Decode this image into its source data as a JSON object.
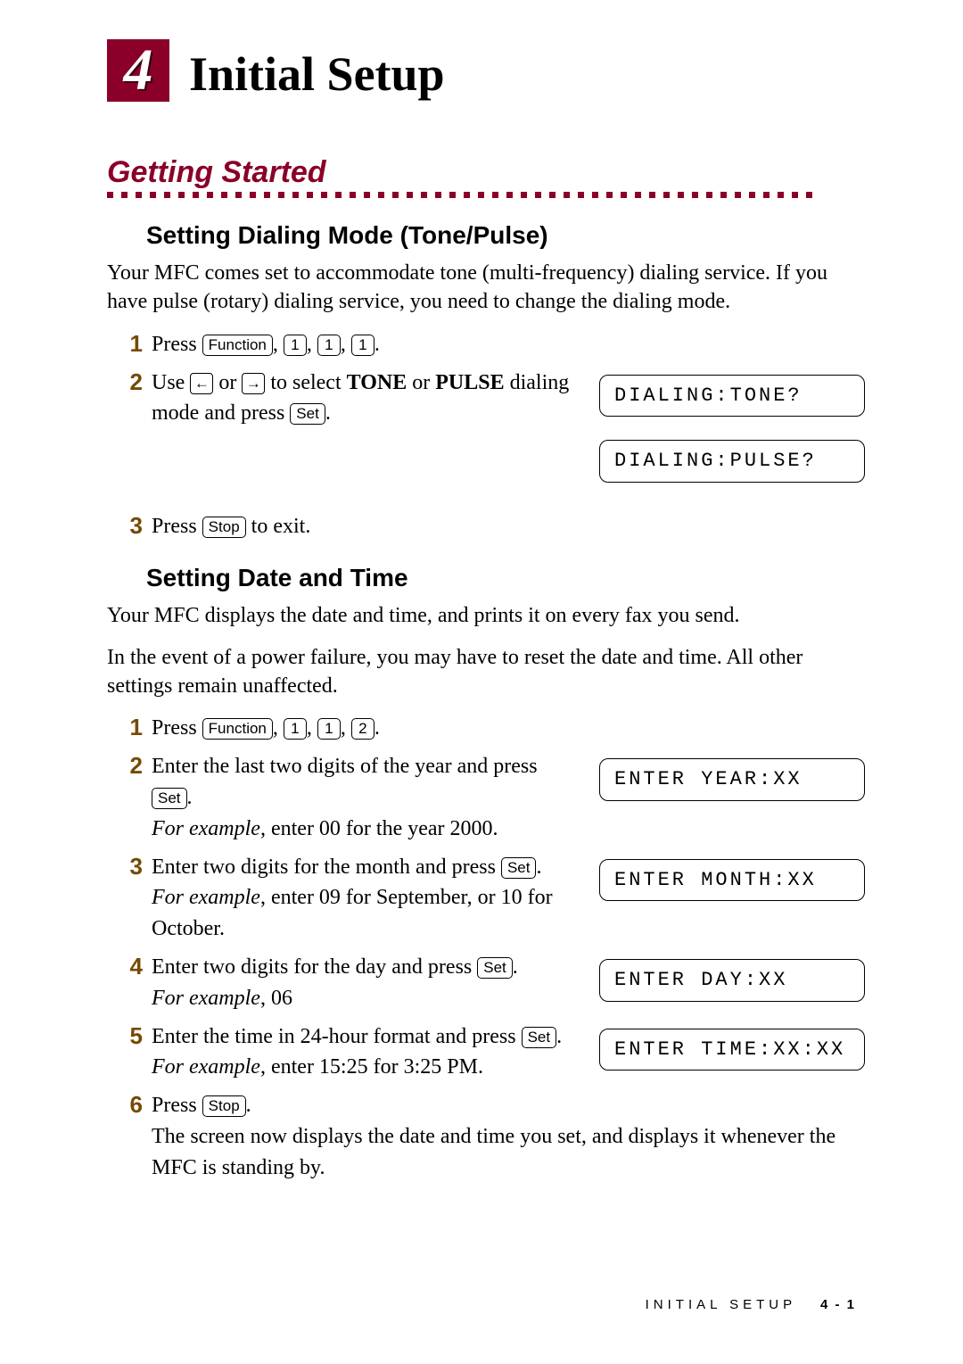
{
  "chapter": {
    "number": "4",
    "title": "Initial Setup"
  },
  "h1": "Getting Started",
  "dialing": {
    "heading": "Setting Dialing Mode (Tone/Pulse)",
    "intro": "Your MFC comes set to accommodate tone (multi-frequency) dialing service. If you have pulse (rotary) dialing service, you need to change the dialing mode.",
    "steps": {
      "s1": {
        "num": "1",
        "pre": "Press ",
        "k_function": "Function",
        "k1": "1",
        "k2": "1",
        "k3": "1"
      },
      "s2": {
        "num": "2",
        "pre": "Use ",
        "mid": " or ",
        "post1": " to select ",
        "b1": "TONE",
        "or": " or ",
        "b2": "PULSE",
        "post2": " dialing mode and press ",
        "k_set": "Set",
        "lcd_tone": "DIALING:TONE?",
        "lcd_pulse": "DIALING:PULSE?"
      },
      "s3": {
        "num": "3",
        "pre": "Press ",
        "k_stop": "Stop",
        "post": " to exit."
      }
    }
  },
  "datetime": {
    "heading": "Setting Date and Time",
    "p1": "Your MFC displays the date and time, and prints it on every fax you send.",
    "p2": "In the event of a power failure, you may have to reset the date and time. All other settings remain unaffected.",
    "steps": {
      "s1": {
        "num": "1",
        "pre": "Press ",
        "k_function": "Function",
        "k1": "1",
        "k2": "1",
        "k3": "2"
      },
      "s2": {
        "num": "2",
        "l1": "Enter the last two digits of the year and press ",
        "k_set": "Set",
        "ex_lead": "For example",
        "ex_rest": ", enter 00 for the year 2000.",
        "lcd": "ENTER YEAR:XX"
      },
      "s3": {
        "num": "3",
        "l1": "Enter two digits for the month and press ",
        "k_set": "Set",
        "ex_lead": "For example",
        "ex_rest": ", enter 09 for September, or 10 for October.",
        "lcd": "ENTER MONTH:XX"
      },
      "s4": {
        "num": "4",
        "l1": "Enter two digits for the day and press ",
        "k_set": "Set",
        "ex_lead": "For example",
        "ex_rest": ", 06",
        "lcd": "ENTER DAY:XX"
      },
      "s5": {
        "num": "5",
        "l1": "Enter the time in 24-hour format and press ",
        "k_set": "Set",
        "ex_lead": "For example",
        "ex_rest": ", enter 15:25 for 3:25 PM.",
        "lcd": "ENTER TIME:XX:XX"
      },
      "s6": {
        "num": "6",
        "pre": "Press ",
        "k_stop": "Stop",
        "post": "The screen now displays the date and time you set, and displays it whenever the MFC is standing by."
      }
    }
  },
  "footer": {
    "running": "INITIAL SETUP",
    "page": "4 - 1"
  },
  "arrows": {
    "left": "←",
    "right": "→"
  }
}
